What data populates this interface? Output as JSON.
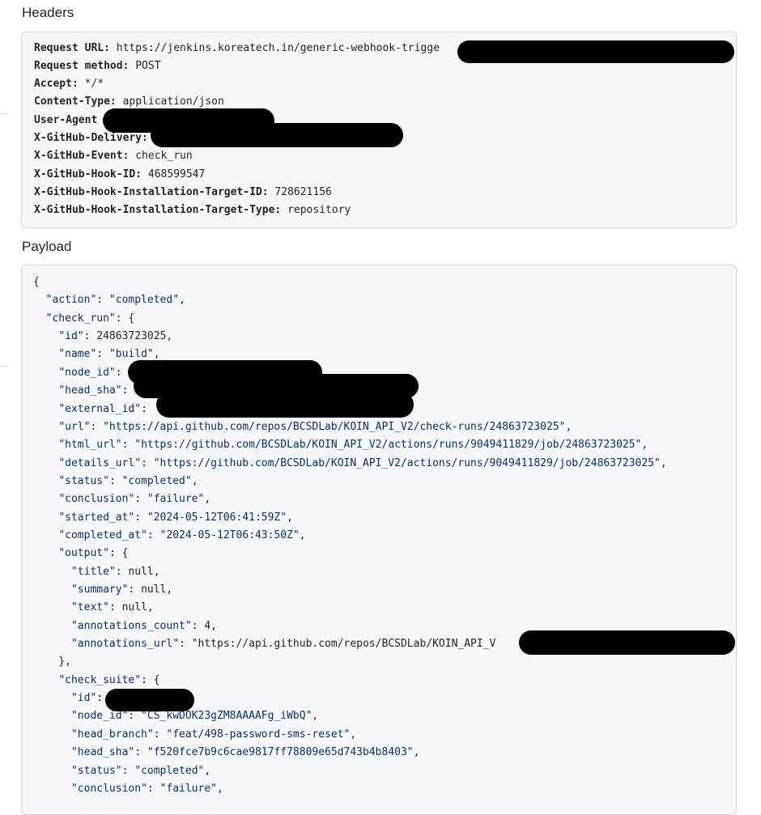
{
  "headers_section": {
    "title": "Headers",
    "lines": [
      {
        "key": "Request URL:",
        "value": "https://jenkins.koreatech.in/generic-webhook-trigge"
      },
      {
        "key": "Request method:",
        "value": "POST"
      },
      {
        "key": "Accept:",
        "value": "*/*"
      },
      {
        "key": "Content-Type:",
        "value": "application/json"
      },
      {
        "key": "User-Agent",
        "value": ""
      },
      {
        "key": "X-GitHub-Delivery:",
        "value": ""
      },
      {
        "key": "X-GitHub-Event:",
        "value": "check_run"
      },
      {
        "key": "X-GitHub-Hook-ID:",
        "value": "468599547"
      },
      {
        "key": "X-GitHub-Hook-Installation-Target-ID:",
        "value": "728621156"
      },
      {
        "key": "X-GitHub-Hook-Installation-Target-Type:",
        "value": "repository"
      }
    ]
  },
  "payload_section": {
    "title": "Payload",
    "lines": [
      "{",
      "  \"action\": \"completed\",",
      "  \"check_run\": {",
      "    \"id\": 24863723025,",
      "    \"name\": \"build\",",
      "    \"node_id\":",
      "    \"head_sha\":",
      "    \"external_id\":",
      "    \"url\": \"https://api.github.com/repos/BCSDLab/KOIN_API_V2/check-runs/24863723025\",",
      "    \"html_url\": \"https://github.com/BCSDLab/KOIN_API_V2/actions/runs/9049411829/job/24863723025\",",
      "    \"details_url\": \"https://github.com/BCSDLab/KOIN_API_V2/actions/runs/9049411829/job/24863723025\",",
      "    \"status\": \"completed\",",
      "    \"conclusion\": \"failure\",",
      "    \"started_at\": \"2024-05-12T06:41:59Z\",",
      "    \"completed_at\": \"2024-05-12T06:43:50Z\",",
      "    \"output\": {",
      "      \"title\": null,",
      "      \"summary\": null,",
      "      \"text\": null,",
      "      \"annotations_count\": 4,",
      "      \"annotations_url\": \"https://api.github.com/repos/BCSDLab/KOIN_API_V",
      "    },",
      "    \"check_suite\": {",
      "      \"id\":",
      "      \"node_id\": \"CS_kwDOK23gZM8AAAAFg_iWbQ\",",
      "      \"head_branch\": \"feat/498-password-sms-reset\",",
      "      \"head_sha\": \"f520fce7b9c6cae9817ff78809e65d743b4b8403\",",
      "      \"status\": \"completed\",",
      "      \"conclusion\": \"failure\","
    ]
  },
  "colors": {
    "panel_bg": "#f6f8fa",
    "panel_border": "#d0d7de",
    "text": "#1f2328",
    "string": "#0a3069",
    "redaction": "#000000"
  }
}
